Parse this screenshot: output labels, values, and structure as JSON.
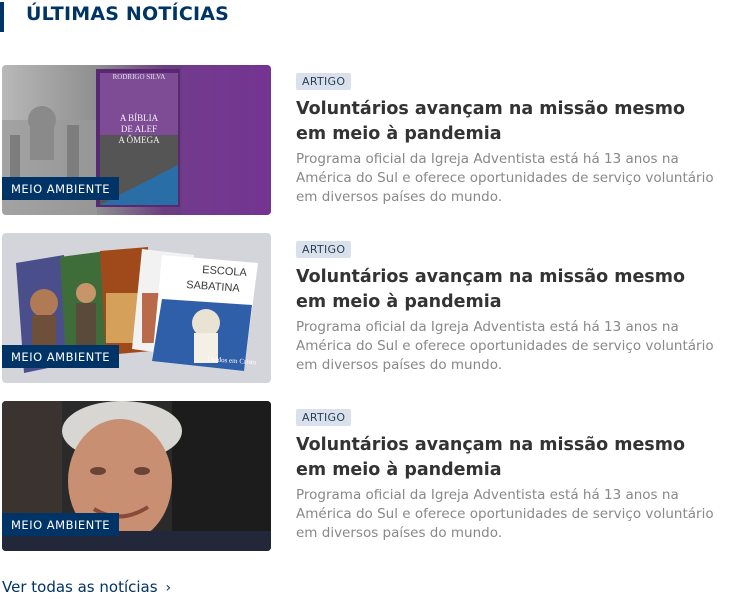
{
  "section": {
    "title": "ÚLTIMAS NOTÍCIAS"
  },
  "articles": [
    {
      "category": "MEIO AMBIENTE",
      "type": "ARTIGO",
      "headline": "Voluntários avançam na missão mesmo em meio à pandemia",
      "summary": "Programa oficial da Igreja Adventista está há 13 anos na América do Sul e oferece oportunidades de serviço voluntário em diversos países do mundo.",
      "image": {
        "book_author": "RODRIGO SILVA",
        "book_title_lines": [
          "A BÍBLIA",
          "DE ALEF",
          "A ÔMEGA"
        ]
      }
    },
    {
      "category": "MEIO AMBIENTE",
      "type": "ARTIGO",
      "headline": "Voluntários avançam na missão mesmo em meio à pandemia",
      "summary": "Programa oficial da Igreja Adventista está há 13 anos na América do Sul e oferece oportunidades de serviço voluntário em diversos países do mundo.",
      "image": {
        "magazine_title_lines": [
          "ESCOLA",
          "SABATINA"
        ],
        "magazine_subtitle": "Unidos em Cristo"
      }
    },
    {
      "category": "MEIO AMBIENTE",
      "type": "ARTIGO",
      "headline": "Voluntários avançam na missão mesmo em meio à pandemia",
      "summary": "Programa oficial da Igreja Adventista está há 13 anos na América do Sul e oferece oportunidades de serviço voluntário em diversos países do mundo.",
      "image": {}
    }
  ],
  "footer": {
    "see_all_label": "Ver todas as notícias",
    "chevron": "›"
  },
  "colors": {
    "brand": "#003366",
    "tag_bg": "#d9e2ec",
    "summary": "#888888"
  }
}
